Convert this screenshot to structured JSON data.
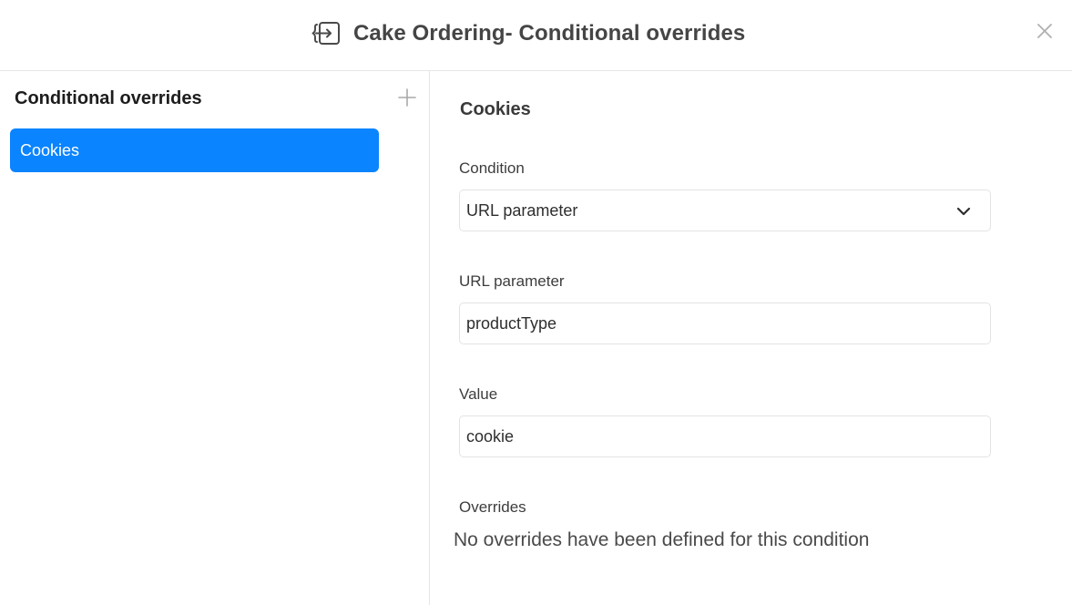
{
  "header": {
    "title": "Cake Ordering- Conditional overrides",
    "title_icon": "exit-brackets-icon",
    "close_icon": "close-icon"
  },
  "sidebar": {
    "title": "Conditional overrides",
    "add_icon": "plus-icon",
    "items": [
      {
        "label": "Cookies",
        "selected": true
      }
    ]
  },
  "main": {
    "section_title": "Cookies",
    "condition": {
      "label": "Condition",
      "value": "URL parameter",
      "icon": "chevron-down-icon"
    },
    "url_parameter": {
      "label": "URL parameter",
      "value": "productType"
    },
    "value_field": {
      "label": "Value",
      "value": "cookie"
    },
    "overrides": {
      "label": "Overrides",
      "empty_message": "No overrides have been defined for this condition"
    }
  },
  "colors": {
    "accent": "#0a84ff",
    "border": "#e3e3e3",
    "text": "#3a3a3a"
  }
}
